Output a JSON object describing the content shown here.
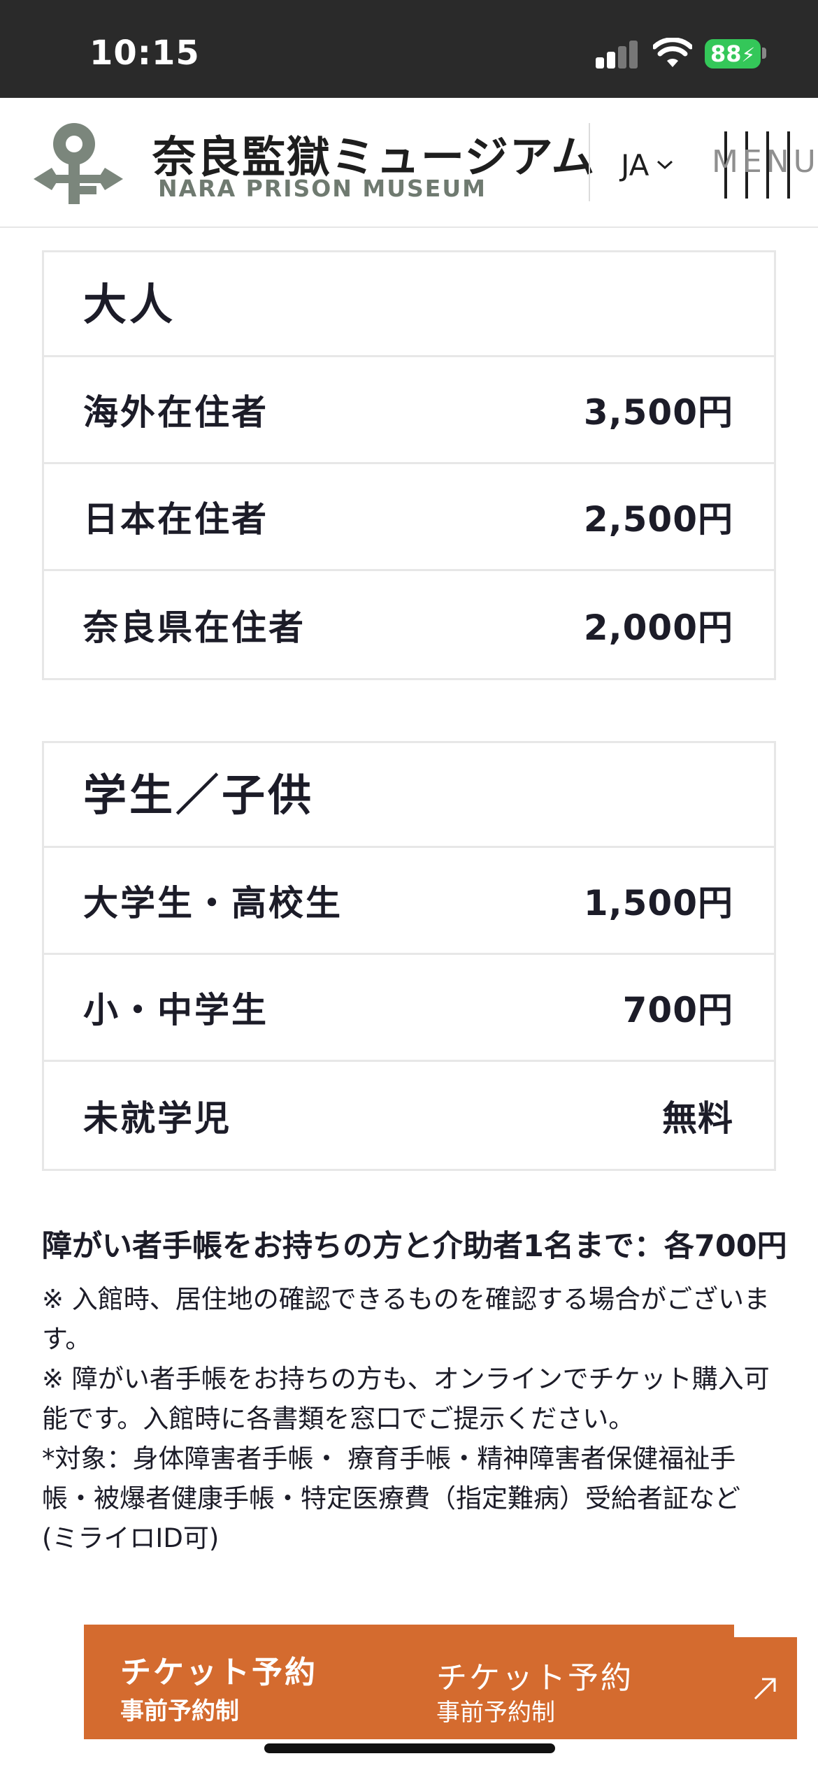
{
  "status_bar": {
    "time": "10:15",
    "battery": "88"
  },
  "header": {
    "logo_jp": "奈良監獄ミュージアム",
    "logo_en": "NARA PRISON MUSEUM",
    "lang": "JA",
    "menu": "MENU"
  },
  "adult_card": {
    "heading": "大人",
    "rows": [
      {
        "label": "海外在住者",
        "price": "3,500円"
      },
      {
        "label": "日本在住者",
        "price": "2,500円"
      },
      {
        "label": "奈良県在住者",
        "price": "2,000円"
      }
    ]
  },
  "student_card": {
    "heading": "学生／子供",
    "rows": [
      {
        "label": "大学生・高校生",
        "price": "1,500円"
      },
      {
        "label": "小・中学生",
        "price": "700円"
      },
      {
        "label": "未就学児",
        "price": "無料"
      }
    ]
  },
  "disability_note": "障がい者手帳をお持ちの方と介助者1名まで：各700円",
  "notes": [
    "※ 入館時、居住地の確認できるものを確認する場合がございます。",
    "※ 障がい者手帳をお持ちの方も、オンラインでチケット購入可能です。入館時に各書類を窓口でご提示ください。",
    "*対象：身体障害者手帳・ 療育手帳・精神障害者保健福祉手帳・被爆者健康手帳・特定医療費（指定難病）受給者証など(ミライロID可)"
  ],
  "cta": {
    "main": "チケット予約",
    "sub": "事前予約制",
    "main_alt": "チケット予約",
    "sub_alt": "事前予約制"
  },
  "colors": {
    "accent": "#d46b2f",
    "status_bar_bg": "#2a2a2a",
    "battery": "#34c759",
    "logo_gray": "#6f7a70",
    "text": "#1c1c28",
    "border": "#e7e7e7"
  },
  "icons": [
    "key-logo-icon",
    "signal-icon",
    "wifi-icon",
    "battery-icon",
    "chevron-down-icon",
    "external-arrow-icon"
  ]
}
